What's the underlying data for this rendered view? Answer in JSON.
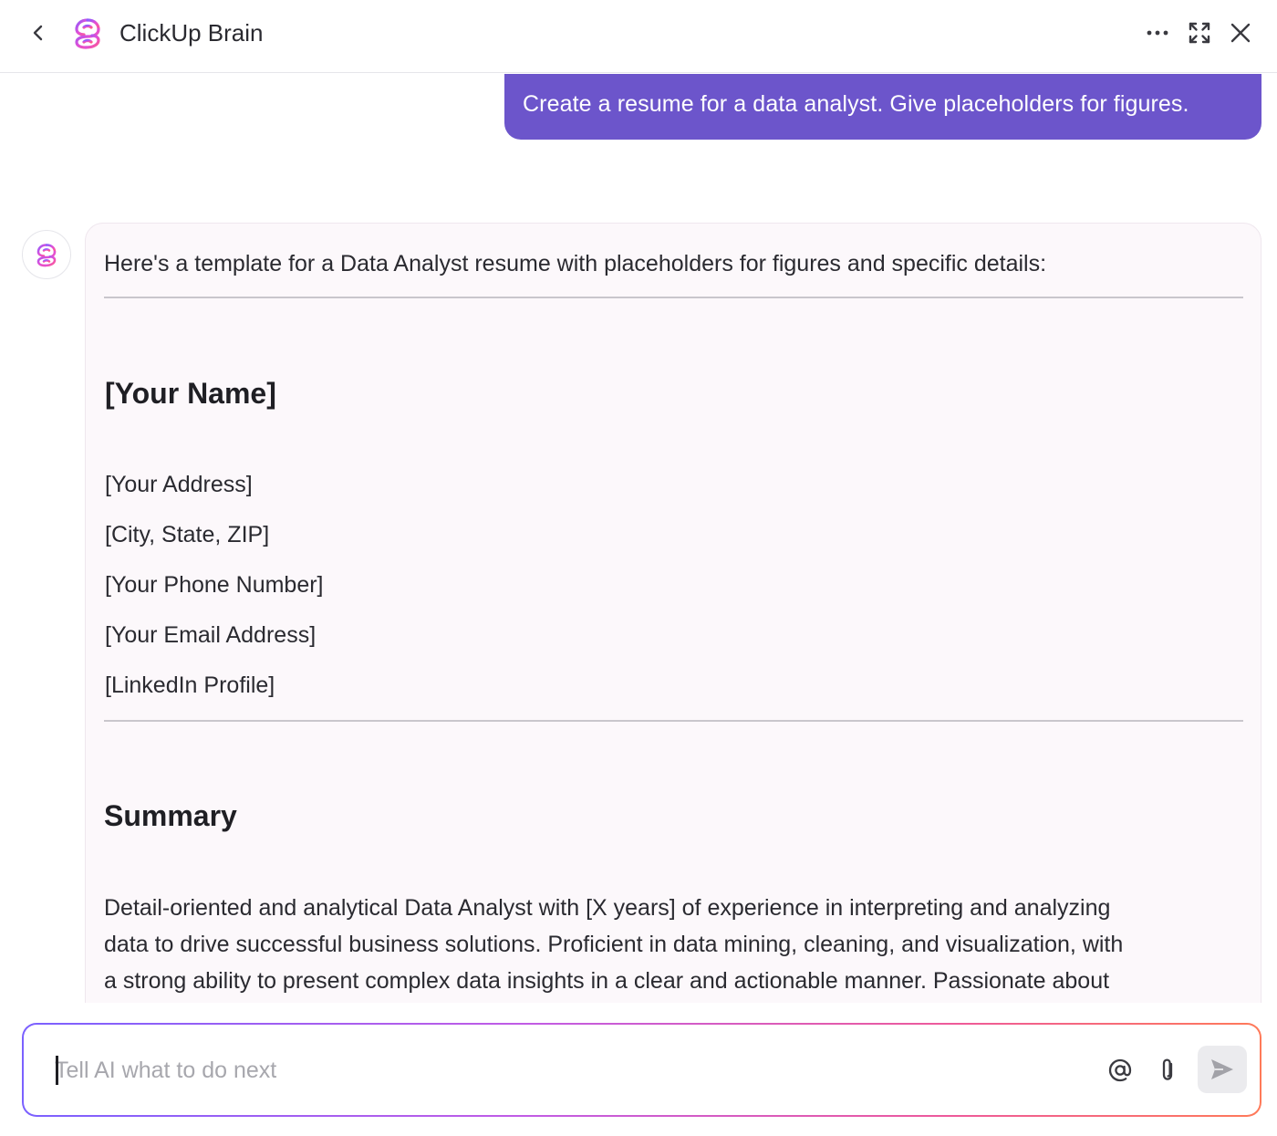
{
  "header": {
    "title": "ClickUp Brain",
    "icons": {
      "back": "chevron-left-icon",
      "logo": "clickup-brain-logo",
      "more": "more-horizontal-icon",
      "expand": "expand-icon",
      "close": "close-icon"
    }
  },
  "colors": {
    "user_bubble": "#6c55cb",
    "ai_card": "#fcf8fb",
    "composer_gradient": [
      "#7b61ff",
      "#c05ce6",
      "#ee5a9a",
      "#ff7a59"
    ]
  },
  "conversation": {
    "user_message": "Create a resume for a data analyst. Give placeholders for figures.",
    "ai_response": {
      "intro": "Here's a template for a Data Analyst resume with placeholders for figures and specific details:",
      "name_heading": "[Your Name]",
      "contact_lines": [
        "[Your Address]",
        "[City, State, ZIP]",
        "[Your Phone Number]",
        "[Your Email Address]",
        "[LinkedIn Profile]"
      ],
      "summary_heading": "Summary",
      "summary_lines": [
        "Detail-oriented and analytical Data Analyst with [X years] of experience in interpreting and analyzing",
        "data to drive successful business solutions. Proficient in data mining, cleaning, and visualization, with",
        "a strong ability to present complex data insights in a clear and actionable manner. Passionate about"
      ]
    }
  },
  "composer": {
    "placeholder": "Tell AI what to do next",
    "icons": {
      "mention": "at-sign-icon",
      "attach": "paperclip-icon",
      "send": "send-icon"
    }
  }
}
